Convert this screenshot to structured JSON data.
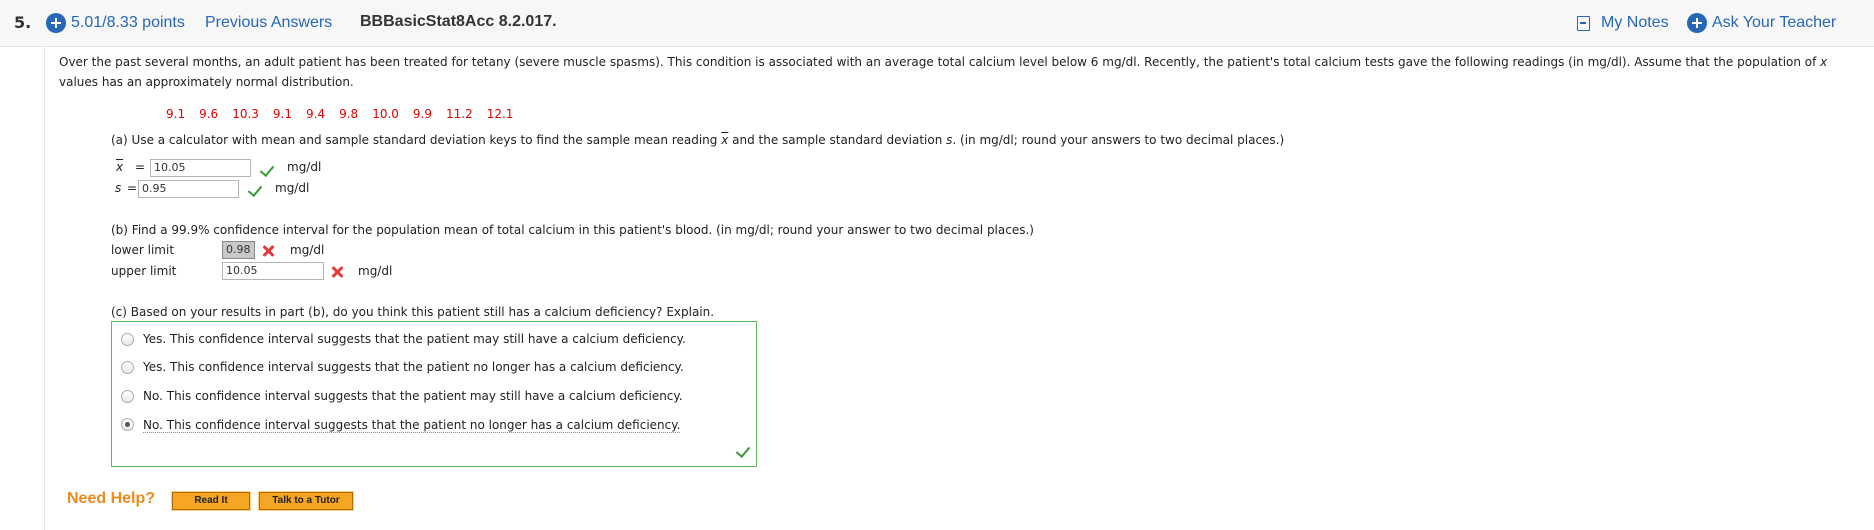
{
  "header": {
    "question_number": "5.",
    "points": "5.01/8.33 points",
    "previous_answers": "Previous Answers",
    "question_id": "BBBasicStat8Acc 8.2.017.",
    "my_notes": "My Notes",
    "ask_teacher": "Ask Your Teacher",
    "accent_color": "#2667b8"
  },
  "problem": {
    "text_1": "Over the past several months, an adult patient has been treated for tetany (severe muscle spasms). This condition is associated with an average total calcium level below 6 mg/dl. Recently, the patient's total calcium tests gave the following readings (in mg/dl). Assume that the population of ",
    "var_x": "x",
    "text_2": " values has an approximately normal distribution.",
    "readings": [
      "9.1",
      "9.6",
      "10.3",
      "9.1",
      "9.4",
      "9.8",
      "10.0",
      "9.9",
      "11.2",
      "12.1"
    ],
    "readings_color": "#e00000"
  },
  "part_a": {
    "prompt_1": "(a) Use a calculator with mean and sample standard deviation keys to find the sample mean reading ",
    "prompt_x": "x",
    "prompt_2": " and the sample standard deviation ",
    "prompt_s": "s",
    "prompt_3": ". (in mg/dl; round your answers to two decimal places.)",
    "xbar_label": "x",
    "xbar_eq": "=",
    "xbar_value": "10.05",
    "s_label": "s",
    "s_eq": "=",
    "s_value": "0.95",
    "unit": "mg/dl"
  },
  "part_b": {
    "prompt": "(b) Find a 99.9% confidence interval for the population mean of total calcium in this patient's blood. (in mg/dl; round your answer to two decimal places.)",
    "lower_label": "lower limit",
    "lower_value": "0.98",
    "upper_label": "upper limit",
    "upper_value": "10.05",
    "unit": "mg/dl"
  },
  "part_c": {
    "prompt": "(c) Based on your results in part (b), do you think this patient still has a calcium deficiency? Explain.",
    "options": [
      "Yes. This confidence interval suggests that the patient may still have a calcium deficiency.",
      "Yes. This confidence interval suggests that the patient no longer has a calcium deficiency.",
      "No. This confidence interval suggests that the patient may still have a calcium deficiency.",
      "No. This confidence interval suggests that the patient no longer has a calcium deficiency."
    ],
    "selected_index": 3
  },
  "help": {
    "need_help": "Need Help?",
    "read_it": "Read It",
    "talk_tutor": "Talk to a Tutor",
    "color": "#f08a1c"
  }
}
